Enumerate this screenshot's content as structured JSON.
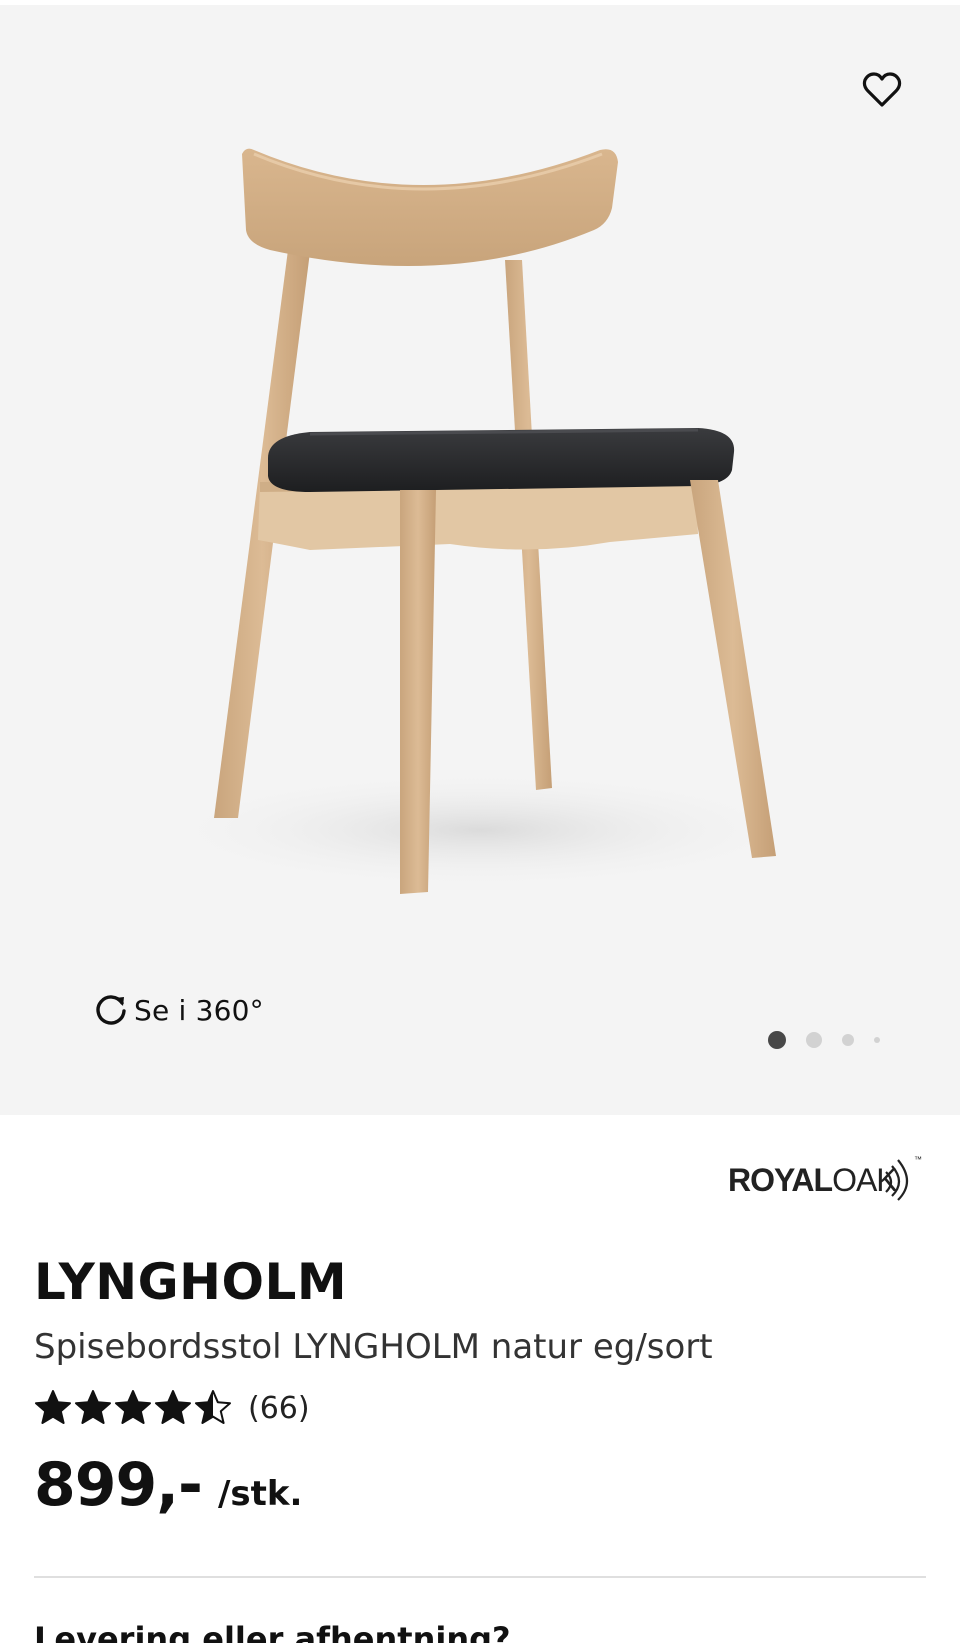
{
  "gallery": {
    "background_color": "#f4f4f4",
    "image_alt": "Spisebordsstol LYNGHOLM natur eg/sort",
    "favorite_icon": "heart-outline-icon",
    "view360_icon": "rotate-icon",
    "view360_label": "Se i 360°",
    "image_count": 4,
    "active_image_index": 0
  },
  "brand": {
    "logo_part1": "ROYAL",
    "logo_part2": "OAK",
    "logo_mark": "™"
  },
  "product": {
    "name": "LYNGHOLM",
    "description": "Spisebordsstol LYNGHOLM natur eg/sort",
    "rating_value": 4.5,
    "rating_max": 5,
    "rating_count": "(66)",
    "price": "899,-",
    "price_unit": "/stk."
  },
  "delivery": {
    "heading": "Levering eller afhentning?"
  }
}
